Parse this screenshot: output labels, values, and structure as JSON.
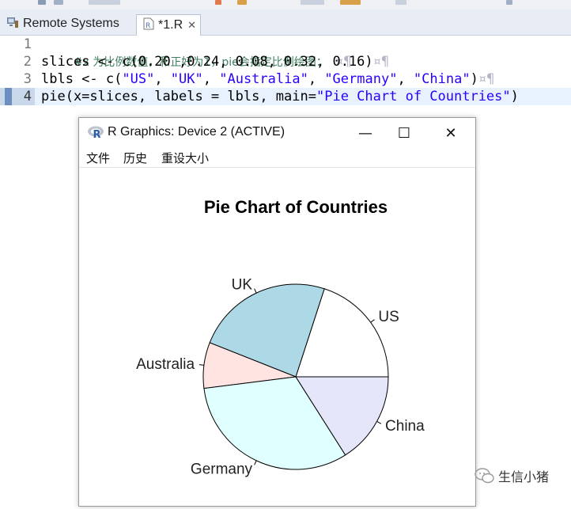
{
  "tabs": {
    "remote_label": "Remote Systems",
    "editor_label": "*1.R",
    "close_glyph": "✕"
  },
  "editor": {
    "line_numbers": [
      "1",
      "2",
      "3",
      "4"
    ],
    "line1_comment": "#x 为比例数值，和正好为1，pie会指定比例绘图：",
    "line2": {
      "a": "slices <- c(",
      "b": "0.20 ,0.24, 0.08, 0.32, 0.16",
      "c": ")"
    },
    "line3": {
      "a": "lbls <- c(",
      "s1": "\"US\"",
      "s2": "\"UK\"",
      "s3": "\"Australia\"",
      "s4": "\"Germany\"",
      "s5": "\"China\"",
      "sep": ", ",
      "c": ")"
    },
    "line4": {
      "a": "pie(x=slices, labels = lbls, main=",
      "s": "\"Pie Chart of Countries\"",
      "c": ")"
    }
  },
  "rwindow": {
    "title": "R Graphics: Device 2 (ACTIVE)",
    "menu": [
      "文件",
      "历史",
      "重设大小"
    ],
    "buttons": {
      "minimize": "—",
      "maximize": "☐",
      "close": "✕"
    }
  },
  "chart_data": {
    "type": "pie",
    "title": "Pie Chart of Countries",
    "categories": [
      "US",
      "UK",
      "Australia",
      "Germany",
      "China"
    ],
    "values": [
      0.2,
      0.24,
      0.08,
      0.32,
      0.16
    ],
    "colors": [
      "#ffffff",
      "#add8e6",
      "#ffe4e1",
      "#e0ffff",
      "#e6e6fa"
    ],
    "start_angle_deg": 0,
    "direction": "counterclockwise"
  },
  "watermark": "生信小猪"
}
